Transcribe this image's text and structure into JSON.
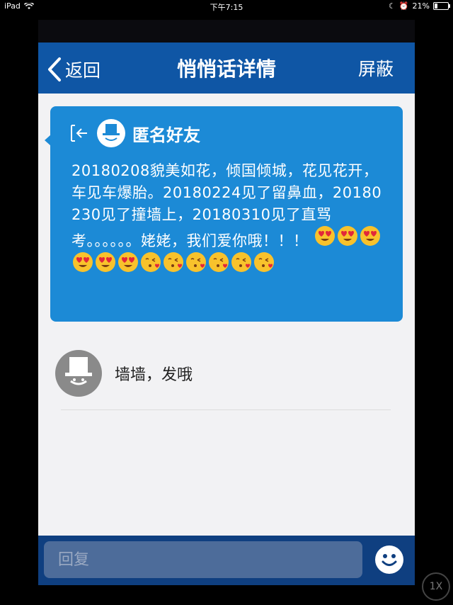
{
  "status_bar": {
    "device": "iPad",
    "time": "下午7:15",
    "battery": "21%",
    "battery_level": 0.21
  },
  "navbar": {
    "back_label": "返回",
    "title": "悄悄话详情",
    "right_label": "屏蔽"
  },
  "message": {
    "sender": "匿名好友",
    "text": "20180208貌美如花，倾国倾城，花见花开，车见车爆胎。20180224见了留鼻血，20180230见了撞墙上，20180310见了直骂考。。。。。。姥姥，我们爱你哦！！！",
    "emojis": [
      "heart-eyes",
      "heart-eyes",
      "heart-eyes",
      "heart-eyes",
      "heart-eyes",
      "heart-eyes",
      "kissing-heart",
      "kissing-heart",
      "kissing-heart",
      "kissing-heart",
      "kissing-heart",
      "kissing-heart"
    ]
  },
  "reply": {
    "text": "墙墙，发哦"
  },
  "input": {
    "placeholder": "回复"
  },
  "zoom": "1X",
  "colors": {
    "nav_blue": "#0f56a5",
    "bubble_blue": "#1c8ad6",
    "bottom_bar": "#0f3f80",
    "emoji_yellow": "#f8c22c"
  }
}
